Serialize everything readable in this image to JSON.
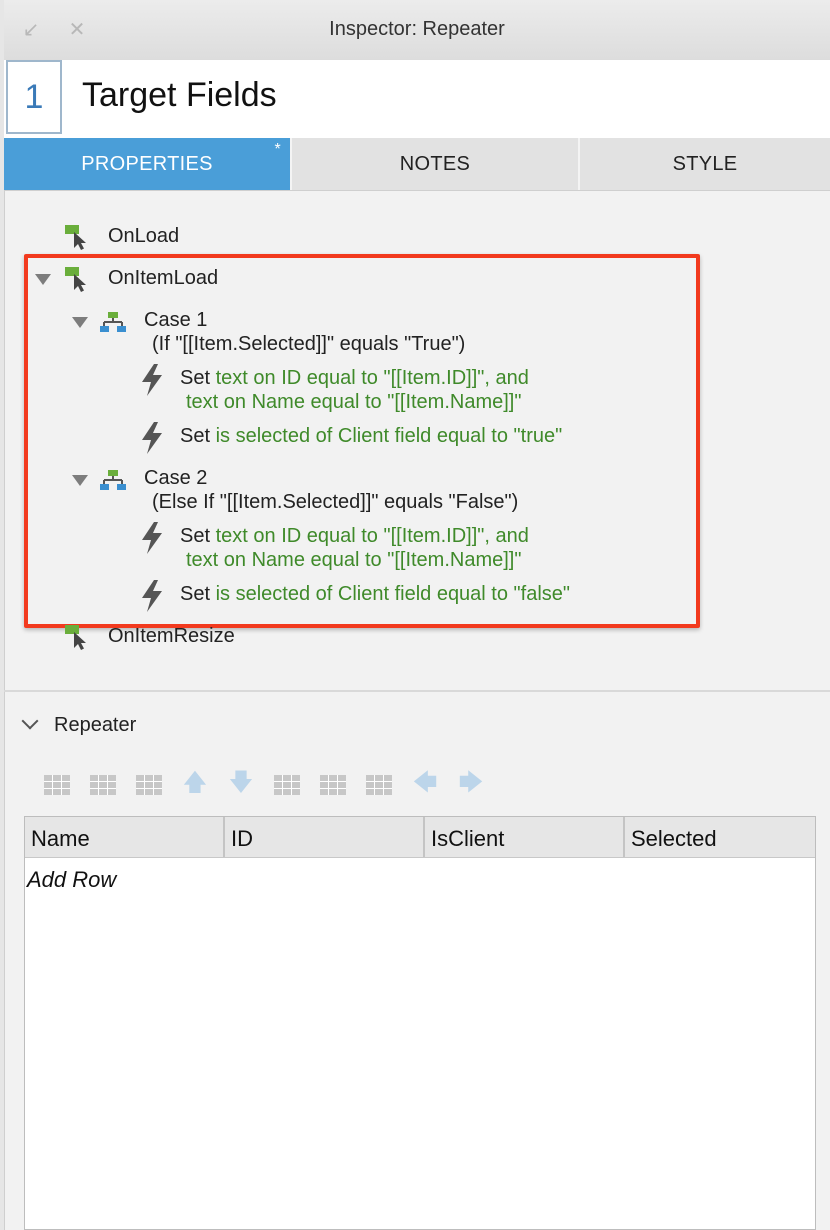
{
  "window": {
    "title": "Inspector: Repeater"
  },
  "header": {
    "number": "1",
    "name": "Target Fields"
  },
  "tabs": [
    {
      "label": "PROPERTIES",
      "modified_marker": "*"
    },
    {
      "label": "NOTES"
    },
    {
      "label": "STYLE"
    }
  ],
  "events": {
    "onload": "OnLoad",
    "onitemload": "OnItemLoad",
    "case1": {
      "label": "Case 1",
      "condition": "(If \"[[Item.Selected]]\" equals \"True\")",
      "action1": {
        "verb": "Set",
        "line1": "text on ID equal to \"[[Item.ID]]\", and",
        "line2": "text on Name equal to \"[[Item.Name]]\""
      },
      "action2": {
        "verb": "Set",
        "line1": "is selected of Client field equal to \"true\""
      }
    },
    "case2": {
      "label": "Case 2",
      "condition": "(Else If \"[[Item.Selected]]\" equals \"False\")",
      "action1": {
        "verb": "Set",
        "line1": "text on ID equal to \"[[Item.ID]]\", and",
        "line2": "text on Name equal to \"[[Item.Name]]\""
      },
      "action2": {
        "verb": "Set",
        "line1": "is selected of Client field equal to \"false\""
      }
    },
    "onitemresize": "OnItemResize"
  },
  "repeater": {
    "section_title": "Repeater",
    "columns": [
      "Name",
      "ID",
      "IsClient",
      "Selected"
    ],
    "add_row": "Add Row"
  },
  "colors": {
    "tab_active": "#4a9ed8",
    "action_text": "#3f8a2a",
    "highlight_border": "#f23a1e",
    "event_icon_green": "#6aae3b"
  }
}
